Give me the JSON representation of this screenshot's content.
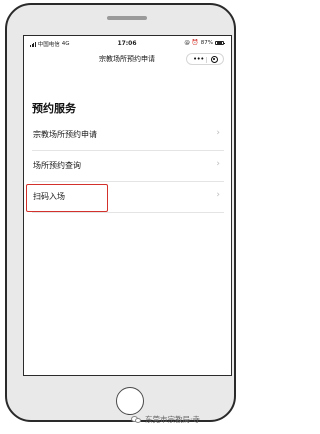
{
  "status_bar": {
    "carrier": "中国电信",
    "network": "4G",
    "time": "17:06",
    "battery_text": "87%",
    "battery_level": 0.87,
    "indicator_icons": [
      "at-icon",
      "alarm-icon"
    ]
  },
  "nav": {
    "title": "宗教场所预约申请",
    "more_label": "•••"
  },
  "content": {
    "section_title": "预约服务",
    "items": [
      {
        "label": "宗教场所预约申请",
        "chevron": "›"
      },
      {
        "label": "场所预约查询",
        "chevron": "›"
      },
      {
        "label": "扫码入场",
        "chevron": "›"
      }
    ]
  },
  "highlight": {
    "color": "#d2322b"
  },
  "watermark": {
    "text": "东莞市宗教局·寺"
  }
}
